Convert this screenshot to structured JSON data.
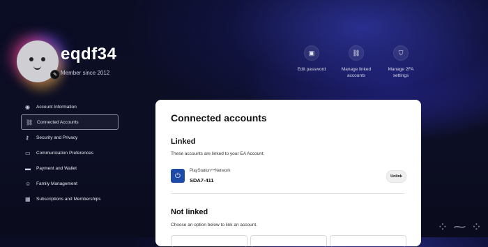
{
  "profile": {
    "username": "eqdf34",
    "member_since": "Member since 2012"
  },
  "quick_actions": [
    {
      "label": "Edit password",
      "icon": "password-icon"
    },
    {
      "label": "Manage linked accounts",
      "icon": "link-icon"
    },
    {
      "label": "Manage 2FA settings",
      "icon": "shield-icon"
    }
  ],
  "sidebar": {
    "items": [
      {
        "label": "Account Information",
        "icon": "user-circle-icon"
      },
      {
        "label": "Connected Accounts",
        "icon": "link-icon",
        "active": true
      },
      {
        "label": "Security and Privacy",
        "icon": "key-icon"
      },
      {
        "label": "Communication Preferences",
        "icon": "chat-icon"
      },
      {
        "label": "Payment and Wallet",
        "icon": "card-icon"
      },
      {
        "label": "Family Management",
        "icon": "family-icon"
      },
      {
        "label": "Subscriptions and Memberships",
        "icon": "subscription-icon"
      }
    ]
  },
  "card": {
    "title": "Connected accounts",
    "linked": {
      "title": "Linked",
      "description": "These accounts are linked to your EA Account.",
      "account": {
        "network": "PlayStation™Network",
        "id": "SDA7-411",
        "unlink_label": "Unlink"
      }
    },
    "not_linked": {
      "title": "Not linked",
      "description": "Choose an option below to link an account."
    }
  },
  "colors": {
    "background": "#0b0d25",
    "accent": "#2a2f8f",
    "psn_blue": "#1f4ba8"
  }
}
